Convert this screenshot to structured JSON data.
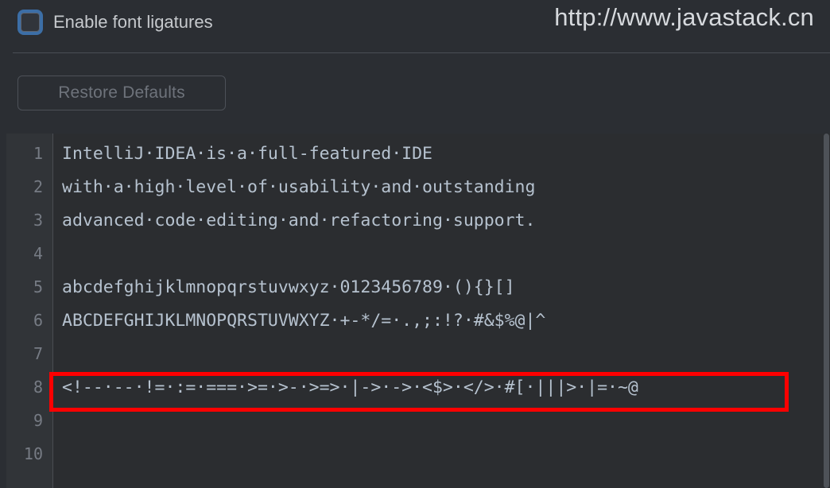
{
  "watermark": {
    "text": "http://www.javastack.cn"
  },
  "settings": {
    "ligatures_checkbox": {
      "label": "Enable font ligatures",
      "checked": false,
      "icon": "checkbox-unchecked-icon"
    },
    "restore_defaults_label": "Restore Defaults"
  },
  "editor_preview": {
    "lines": [
      {
        "number": "1",
        "text": "IntelliJ·IDEA·is·a·full-featured·IDE"
      },
      {
        "number": "2",
        "text": "with·a·high·level·of·usability·and·outstanding"
      },
      {
        "number": "3",
        "text": "advanced·code·editing·and·refactoring·support."
      },
      {
        "number": "4",
        "text": ""
      },
      {
        "number": "5",
        "text": "abcdefghijklmnopqrstuvwxyz·0123456789·(){}[]"
      },
      {
        "number": "6",
        "text": "ABCDEFGHIJKLMNOPQRSTUVWXYZ·+-*/=·.,;:!?·#&$%@|^"
      },
      {
        "number": "7",
        "text": ""
      },
      {
        "number": "8",
        "text": "<!--·--·!=·:=·===·>=·>-·>=>·|->·->·<$>·</>·#[·|||>·|=·~@"
      },
      {
        "number": "9",
        "text": ""
      },
      {
        "number": "10",
        "text": ""
      }
    ],
    "highlighted_line": "8"
  },
  "colors": {
    "panel_background": "#2b2e33",
    "editor_background": "#2b2d30",
    "gutter_background": "#313438",
    "code_text": "#b6c2cf",
    "line_number": "#767b84",
    "accent_blue": "#3c6ea6",
    "annotation_red": "#fe0000",
    "disabled_text": "#6e737b"
  }
}
